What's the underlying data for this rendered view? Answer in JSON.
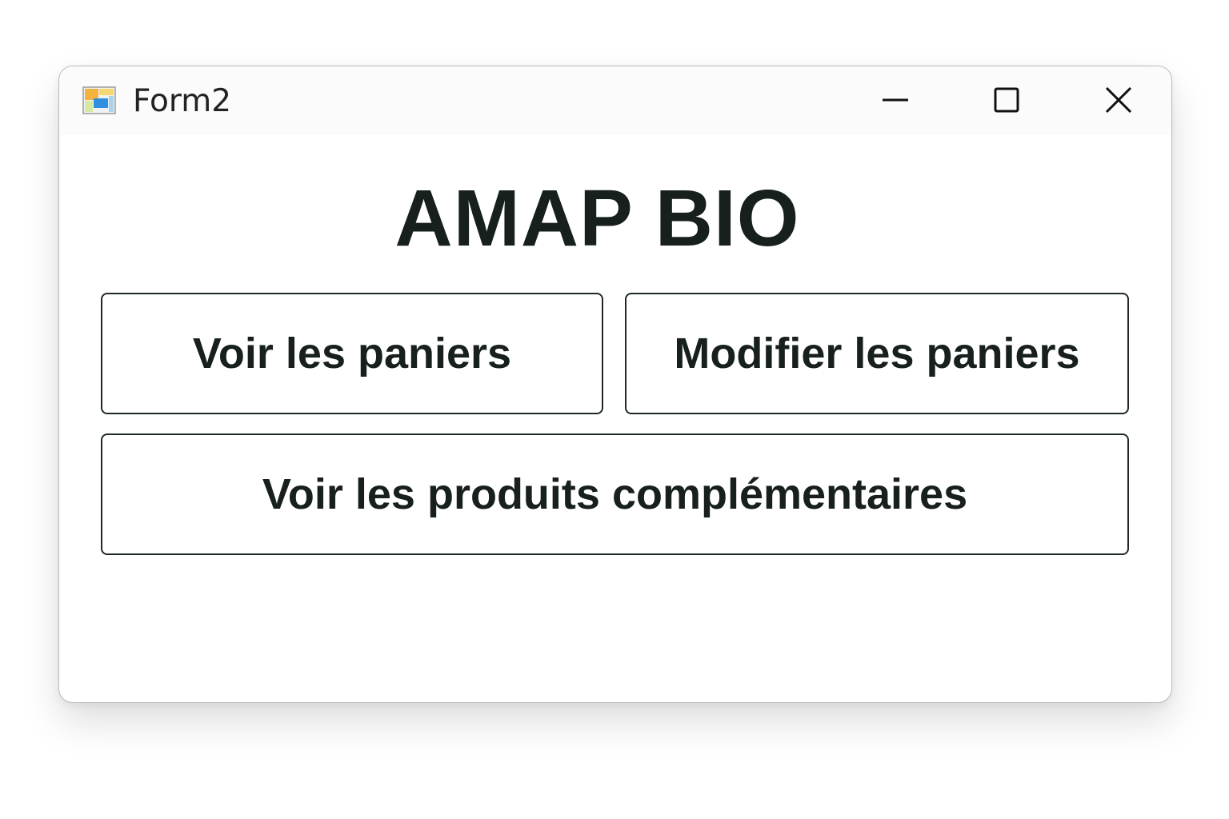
{
  "window": {
    "title": "Form2",
    "icon": "form-app-icon"
  },
  "controls": {
    "minimize_icon": "minimize-icon",
    "maximize_icon": "maximize-icon",
    "close_icon": "close-icon"
  },
  "main": {
    "heading": "AMAP BIO",
    "buttons": [
      {
        "label": "Voir les paniers"
      },
      {
        "label": "Modifier les paniers"
      },
      {
        "label": "Voir les produits complémentaires"
      }
    ]
  },
  "colors": {
    "text": "#17201d",
    "button_border": "#1f2a28",
    "window_background": "#ffffff"
  }
}
